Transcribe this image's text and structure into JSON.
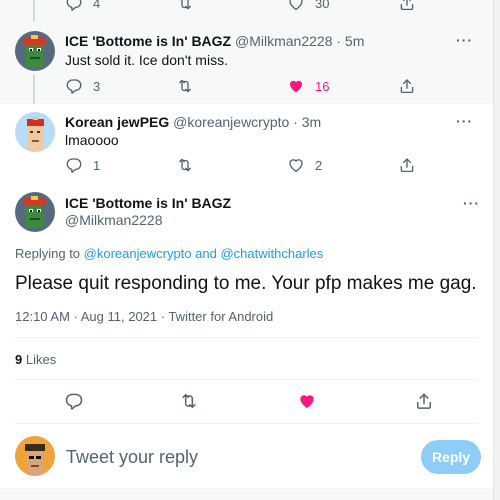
{
  "tweets": [
    {
      "actions": {
        "reply_count": "4",
        "retweet_count": "",
        "like_count": "30"
      }
    },
    {
      "display_name": "ICE 'Bottome is In' BAGZ",
      "handle": "@Milkman2228",
      "time": "· 5m",
      "text": "Just sold it. Ice don't miss.",
      "actions": {
        "reply_count": "3",
        "retweet_count": "",
        "like_count": "16"
      },
      "liked": true
    },
    {
      "display_name": "Korean jewPEG",
      "handle": "@koreanjewcrypto",
      "time": "· 3m",
      "text": "lmaoooo",
      "actions": {
        "reply_count": "1",
        "retweet_count": "",
        "like_count": "2"
      }
    }
  ],
  "main_tweet": {
    "display_name": "ICE 'Bottome is In' BAGZ",
    "handle": "@Milkman2228",
    "replying_prefix": "Replying to",
    "replying_user1": "@koreanjewcrypto",
    "replying_and": "and",
    "replying_user2": "@chatwithcharles",
    "text": "Please quit responding to me. Your pfp makes me gag.",
    "timestamp": "12:10 AM · Aug 11, 2021 · Twitter for Android",
    "likes_count": "9",
    "likes_label": "Likes"
  },
  "reply_box": {
    "placeholder": "Tweet your reply",
    "button_label": "Reply"
  },
  "more_glyph": "···",
  "colors": {
    "accent": "#1d9bf0",
    "like_pink": "#f91880",
    "muted": "#536471",
    "reply_button_disabled": "#8ecdf8"
  },
  "icons": [
    "reply-icon",
    "retweet-icon",
    "like-icon",
    "share-icon",
    "more-icon"
  ]
}
